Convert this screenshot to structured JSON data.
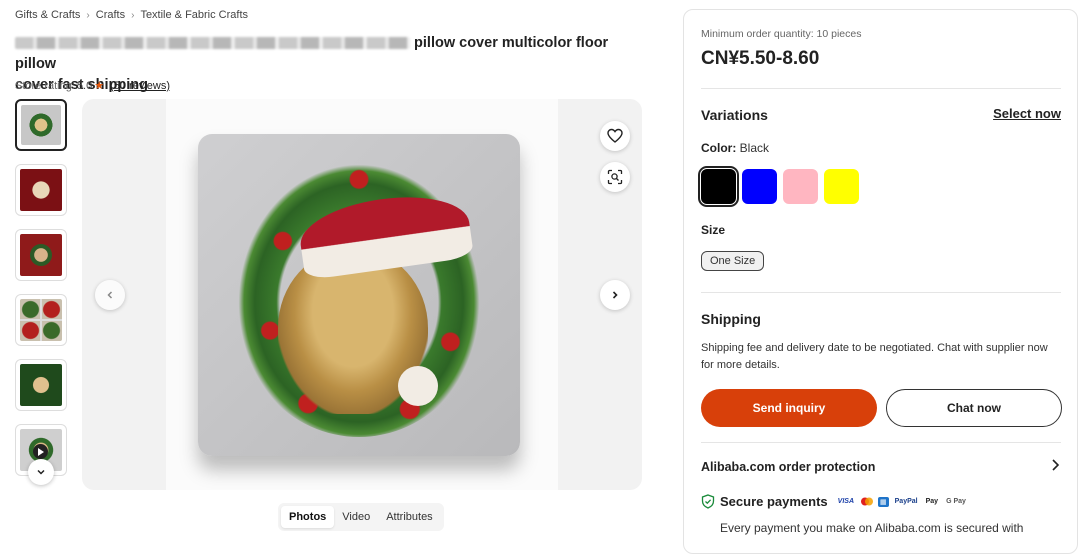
{
  "breadcrumb": [
    "Gifts & Crafts",
    "Crafts",
    "Textile & Fabric Crafts"
  ],
  "product": {
    "title_visible": "pillow cover multicolor floor pillow cover fast shipping",
    "title_end": "pillow cover multicolor floor pillow",
    "title_line2": "cover fast shipping",
    "rating_label": "Store rating:",
    "rating_value": "5.0",
    "reviews": "(50 reviews)"
  },
  "media_tabs": [
    "Photos",
    "Video",
    "Attributes"
  ],
  "thumbnails_count": 6,
  "panel": {
    "moq": "Minimum order quantity: 10 pieces",
    "price": "CN¥5.50-8.60",
    "variations_title": "Variations",
    "select_now": "Select now",
    "color_label": "Color:",
    "color_value": "Black",
    "colors": [
      {
        "name": "Black",
        "hex": "#000000"
      },
      {
        "name": "Blue",
        "hex": "#0000ff"
      },
      {
        "name": "Pink",
        "hex": "#ffb6c1"
      },
      {
        "name": "Yellow",
        "hex": "#ffff00"
      }
    ],
    "size_label": "Size",
    "size_value": "One Size",
    "shipping_title": "Shipping",
    "shipping_text": "Shipping fee and delivery date to be negotiated. Chat with supplier now for more details.",
    "send_inquiry": "Send inquiry",
    "chat_now": "Chat now",
    "protection_title": "Alibaba.com order protection",
    "secure_payments": "Secure payments",
    "secure_desc": "Every payment you make on Alibaba.com is secured with"
  },
  "payment_logos": [
    "VISA",
    "PayPal",
    "Pay",
    "G Pay"
  ],
  "colors": {
    "accent": "#d8400a",
    "star": "#e8590c"
  }
}
